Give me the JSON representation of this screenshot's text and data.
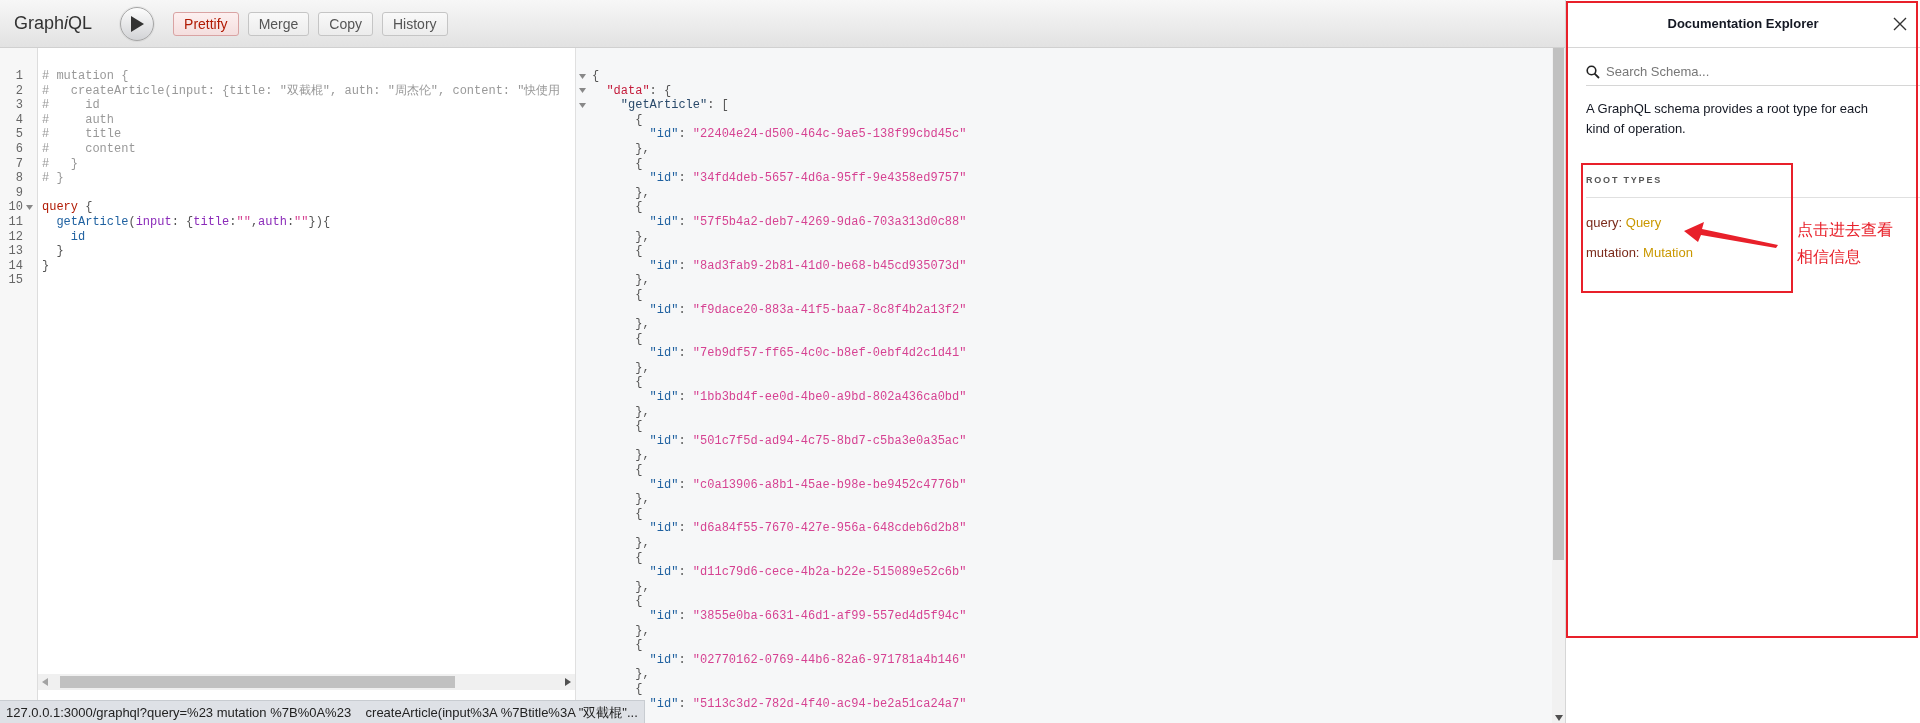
{
  "toolbar": {
    "title": {
      "start": "Graph",
      "italic": "i",
      "end": "QL"
    },
    "buttons": [
      {
        "label": "Prettify",
        "highlighted": true
      },
      {
        "label": "Merge",
        "highlighted": false
      },
      {
        "label": "Copy",
        "highlighted": false
      },
      {
        "label": "History",
        "highlighted": false
      }
    ]
  },
  "editor": {
    "lines": [
      {
        "number": "1",
        "fold": false,
        "tokens": [
          {
            "kind": "comment",
            "text": "# mutation {"
          }
        ]
      },
      {
        "number": "2",
        "fold": false,
        "tokens": [
          {
            "kind": "comment",
            "text": "#   createArticle(input: {title: \"双截棍\", auth: \"周杰伦\", content: \"快使用"
          }
        ]
      },
      {
        "number": "3",
        "fold": false,
        "tokens": [
          {
            "kind": "comment",
            "text": "#     id"
          }
        ]
      },
      {
        "number": "4",
        "fold": false,
        "tokens": [
          {
            "kind": "comment",
            "text": "#     auth"
          }
        ]
      },
      {
        "number": "5",
        "fold": false,
        "tokens": [
          {
            "kind": "comment",
            "text": "#     title"
          }
        ]
      },
      {
        "number": "6",
        "fold": false,
        "tokens": [
          {
            "kind": "comment",
            "text": "#     content"
          }
        ]
      },
      {
        "number": "7",
        "fold": false,
        "tokens": [
          {
            "kind": "comment",
            "text": "#   }"
          }
        ]
      },
      {
        "number": "8",
        "fold": false,
        "tokens": [
          {
            "kind": "comment",
            "text": "# }"
          }
        ]
      },
      {
        "number": "9",
        "fold": false
      },
      {
        "number": "10",
        "fold": true,
        "tokens": [
          {
            "kind": "keyword",
            "text": "query"
          },
          {
            "kind": "punct",
            "text": " {"
          }
        ]
      },
      {
        "number": "11",
        "fold": false,
        "tokens": [
          {
            "kind": "def",
            "text": "  getArticle"
          },
          {
            "kind": "punct",
            "text": "("
          },
          {
            "kind": "attr",
            "text": "input"
          },
          {
            "kind": "punct",
            "text": ": {"
          },
          {
            "kind": "attr",
            "text": "title"
          },
          {
            "kind": "punct",
            "text": ":"
          },
          {
            "kind": "string",
            "text": "\"\""
          },
          {
            "kind": "punct",
            "text": ","
          },
          {
            "kind": "attr",
            "text": "auth"
          },
          {
            "kind": "punct",
            "text": ":"
          },
          {
            "kind": "string",
            "text": "\"\""
          },
          {
            "kind": "punct",
            "text": "}){"
          }
        ]
      },
      {
        "number": "12",
        "fold": false,
        "tokens": [
          {
            "kind": "def",
            "text": "    id"
          }
        ]
      },
      {
        "number": "13",
        "fold": false,
        "tokens": [
          {
            "kind": "punct",
            "text": "  }"
          }
        ]
      },
      {
        "number": "14",
        "fold": false,
        "tokens": [
          {
            "kind": "punct",
            "text": "}"
          }
        ]
      },
      {
        "number": "15",
        "fold": false
      }
    ]
  },
  "result": {
    "lines": [
      {
        "fold": true,
        "tokens": [
          {
            "kind": "punct",
            "text": "{"
          }
        ]
      },
      {
        "fold": true,
        "tokens": [
          {
            "kind": "keyword",
            "text": "  \"data\""
          },
          {
            "kind": "punct",
            "text": ": {"
          }
        ]
      },
      {
        "fold": true,
        "tokens": [
          {
            "kind": "def",
            "text": "    \"getArticle\""
          },
          {
            "kind": "punct",
            "text": ": ["
          }
        ]
      },
      {
        "fold": false,
        "tokens": [
          {
            "kind": "punct",
            "text": "      {"
          }
        ]
      },
      {
        "fold": false,
        "tokens": [
          {
            "kind": "attr",
            "text": "        \"id\""
          },
          {
            "kind": "punct",
            "text": ": "
          },
          {
            "kind": "string",
            "text": "\"22404e24-d500-464c-9ae5-138f99cbd45c\""
          }
        ]
      },
      {
        "fold": false,
        "tokens": [
          {
            "kind": "punct",
            "text": "      },"
          }
        ]
      },
      {
        "fold": false,
        "tokens": [
          {
            "kind": "punct",
            "text": "      {"
          }
        ]
      },
      {
        "fold": false,
        "tokens": [
          {
            "kind": "attr",
            "text": "        \"id\""
          },
          {
            "kind": "punct",
            "text": ": "
          },
          {
            "kind": "string",
            "text": "\"34fd4deb-5657-4d6a-95ff-9e4358ed9757\""
          }
        ]
      },
      {
        "fold": false,
        "tokens": [
          {
            "kind": "punct",
            "text": "      },"
          }
        ]
      },
      {
        "fold": false,
        "tokens": [
          {
            "kind": "punct",
            "text": "      {"
          }
        ]
      },
      {
        "fold": false,
        "tokens": [
          {
            "kind": "attr",
            "text": "        \"id\""
          },
          {
            "kind": "punct",
            "text": ": "
          },
          {
            "kind": "string",
            "text": "\"57f5b4a2-deb7-4269-9da6-703a313d0c88\""
          }
        ]
      },
      {
        "fold": false,
        "tokens": [
          {
            "kind": "punct",
            "text": "      },"
          }
        ]
      },
      {
        "fold": false,
        "tokens": [
          {
            "kind": "punct",
            "text": "      {"
          }
        ]
      },
      {
        "fold": false,
        "tokens": [
          {
            "kind": "attr",
            "text": "        \"id\""
          },
          {
            "kind": "punct",
            "text": ": "
          },
          {
            "kind": "string",
            "text": "\"8ad3fab9-2b81-41d0-be68-b45cd935073d\""
          }
        ]
      },
      {
        "fold": false,
        "tokens": [
          {
            "kind": "punct",
            "text": "      },"
          }
        ]
      },
      {
        "fold": false,
        "tokens": [
          {
            "kind": "punct",
            "text": "      {"
          }
        ]
      },
      {
        "fold": false,
        "tokens": [
          {
            "kind": "attr",
            "text": "        \"id\""
          },
          {
            "kind": "punct",
            "text": ": "
          },
          {
            "kind": "string",
            "text": "\"f9dace20-883a-41f5-baa7-8c8f4b2a13f2\""
          }
        ]
      },
      {
        "fold": false,
        "tokens": [
          {
            "kind": "punct",
            "text": "      },"
          }
        ]
      },
      {
        "fold": false,
        "tokens": [
          {
            "kind": "punct",
            "text": "      {"
          }
        ]
      },
      {
        "fold": false,
        "tokens": [
          {
            "kind": "attr",
            "text": "        \"id\""
          },
          {
            "kind": "punct",
            "text": ": "
          },
          {
            "kind": "string",
            "text": "\"7eb9df57-ff65-4c0c-b8ef-0ebf4d2c1d41\""
          }
        ]
      },
      {
        "fold": false,
        "tokens": [
          {
            "kind": "punct",
            "text": "      },"
          }
        ]
      },
      {
        "fold": false,
        "tokens": [
          {
            "kind": "punct",
            "text": "      {"
          }
        ]
      },
      {
        "fold": false,
        "tokens": [
          {
            "kind": "attr",
            "text": "        \"id\""
          },
          {
            "kind": "punct",
            "text": ": "
          },
          {
            "kind": "string",
            "text": "\"1bb3bd4f-ee0d-4be0-a9bd-802a436ca0bd\""
          }
        ]
      },
      {
        "fold": false,
        "tokens": [
          {
            "kind": "punct",
            "text": "      },"
          }
        ]
      },
      {
        "fold": false,
        "tokens": [
          {
            "kind": "punct",
            "text": "      {"
          }
        ]
      },
      {
        "fold": false,
        "tokens": [
          {
            "kind": "attr",
            "text": "        \"id\""
          },
          {
            "kind": "punct",
            "text": ": "
          },
          {
            "kind": "string",
            "text": "\"501c7f5d-ad94-4c75-8bd7-c5ba3e0a35ac\""
          }
        ]
      },
      {
        "fold": false,
        "tokens": [
          {
            "kind": "punct",
            "text": "      },"
          }
        ]
      },
      {
        "fold": false,
        "tokens": [
          {
            "kind": "punct",
            "text": "      {"
          }
        ]
      },
      {
        "fold": false,
        "tokens": [
          {
            "kind": "attr",
            "text": "        \"id\""
          },
          {
            "kind": "punct",
            "text": ": "
          },
          {
            "kind": "string",
            "text": "\"c0a13906-a8b1-45ae-b98e-be9452c4776b\""
          }
        ]
      },
      {
        "fold": false,
        "tokens": [
          {
            "kind": "punct",
            "text": "      },"
          }
        ]
      },
      {
        "fold": false,
        "tokens": [
          {
            "kind": "punct",
            "text": "      {"
          }
        ]
      },
      {
        "fold": false,
        "tokens": [
          {
            "kind": "attr",
            "text": "        \"id\""
          },
          {
            "kind": "punct",
            "text": ": "
          },
          {
            "kind": "string",
            "text": "\"d6a84f55-7670-427e-956a-648cdeb6d2b8\""
          }
        ]
      },
      {
        "fold": false,
        "tokens": [
          {
            "kind": "punct",
            "text": "      },"
          }
        ]
      },
      {
        "fold": false,
        "tokens": [
          {
            "kind": "punct",
            "text": "      {"
          }
        ]
      },
      {
        "fold": false,
        "tokens": [
          {
            "kind": "attr",
            "text": "        \"id\""
          },
          {
            "kind": "punct",
            "text": ": "
          },
          {
            "kind": "string",
            "text": "\"d11c79d6-cece-4b2a-b22e-515089e52c6b\""
          }
        ]
      },
      {
        "fold": false,
        "tokens": [
          {
            "kind": "punct",
            "text": "      },"
          }
        ]
      },
      {
        "fold": false,
        "tokens": [
          {
            "kind": "punct",
            "text": "      {"
          }
        ]
      },
      {
        "fold": false,
        "tokens": [
          {
            "kind": "attr",
            "text": "        \"id\""
          },
          {
            "kind": "punct",
            "text": ": "
          },
          {
            "kind": "string",
            "text": "\"3855e0ba-6631-46d1-af99-557ed4d5f94c\""
          }
        ]
      },
      {
        "fold": false,
        "tokens": [
          {
            "kind": "punct",
            "text": "      },"
          }
        ]
      },
      {
        "fold": false,
        "tokens": [
          {
            "kind": "punct",
            "text": "      {"
          }
        ]
      },
      {
        "fold": false,
        "tokens": [
          {
            "kind": "attr",
            "text": "        \"id\""
          },
          {
            "kind": "punct",
            "text": ": "
          },
          {
            "kind": "string",
            "text": "\"02770162-0769-44b6-82a6-971781a4b146\""
          }
        ]
      },
      {
        "fold": false,
        "tokens": [
          {
            "kind": "punct",
            "text": "      },"
          }
        ]
      },
      {
        "fold": false,
        "tokens": [
          {
            "kind": "punct",
            "text": "      {"
          }
        ]
      },
      {
        "fold": false,
        "tokens": [
          {
            "kind": "attr",
            "text": "        \"id\""
          },
          {
            "kind": "punct",
            "text": ": "
          },
          {
            "kind": "string",
            "text": "\"5113c3d2-782d-4f40-ac94-be2a51ca24a7\""
          }
        ]
      }
    ]
  },
  "docs": {
    "title": "Documentation Explorer",
    "search": {
      "placeholder": "Search Schema..."
    },
    "description": "A GraphQL schema provides a root type for each kind of operation.",
    "section_title": "ROOT TYPES",
    "root_types": [
      {
        "name": "query:",
        "type": "Query"
      },
      {
        "name": "mutation:",
        "type": "Mutation"
      }
    ]
  },
  "annotation": {
    "note": "点击进去查看相信信息"
  },
  "status_bar": {
    "url": "127.0.0.1:3000/graphql?query=%23 mutation %7B%0A%23    createArticle(input%3A %7Btitle%3A \"双截棍\"..."
  }
}
